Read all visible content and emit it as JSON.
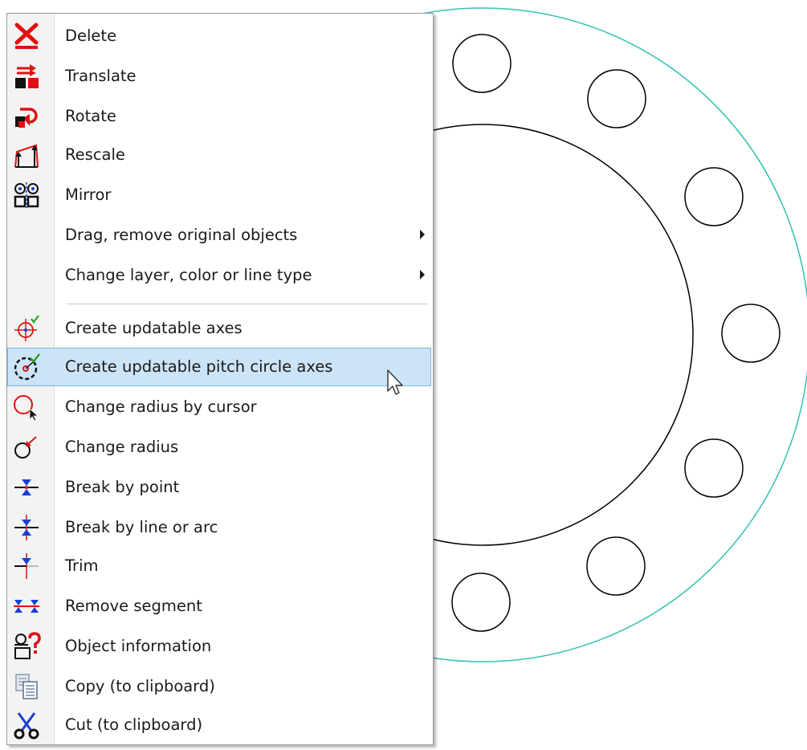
{
  "menu": {
    "items": [
      {
        "icon": "delete-icon",
        "label": "Delete"
      },
      {
        "icon": "translate-icon",
        "label": "Translate"
      },
      {
        "icon": "rotate-icon",
        "label": "Rotate"
      },
      {
        "icon": "rescale-icon",
        "label": "Rescale"
      },
      {
        "icon": "mirror-icon",
        "label": "Mirror"
      },
      {
        "icon": "",
        "label": "Drag, remove original objects",
        "submenu": true
      },
      {
        "icon": "",
        "label": "Change layer, color or line type",
        "submenu": true
      },
      {
        "icon": "updatable-axes-icon",
        "label": "Create updatable axes"
      },
      {
        "icon": "pitch-circle-axes-icon",
        "label": "Create updatable pitch circle axes",
        "highlighted": true
      },
      {
        "icon": "radius-cursor-icon",
        "label": "Change radius by cursor"
      },
      {
        "icon": "change-radius-icon",
        "label": "Change radius"
      },
      {
        "icon": "break-point-icon",
        "label": "Break by point"
      },
      {
        "icon": "break-line-icon",
        "label": "Break by line or arc"
      },
      {
        "icon": "trim-icon",
        "label": "Trim"
      },
      {
        "icon": "remove-segment-icon",
        "label": "Remove segment"
      },
      {
        "icon": "object-info-icon",
        "label": "Object information"
      },
      {
        "icon": "copy-icon",
        "label": "Copy (to clipboard)"
      },
      {
        "icon": "cut-icon",
        "label": "Cut (to clipboard)"
      }
    ]
  },
  "colors": {
    "outer_circle": "#36c2b4",
    "geometry": "#000000",
    "highlight": "#cce4f7",
    "red": "#e01010",
    "blue": "#1a3fd0"
  }
}
